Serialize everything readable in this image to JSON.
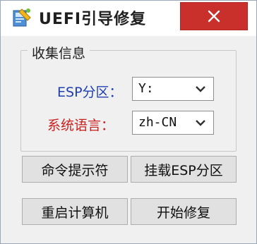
{
  "window": {
    "title": "UEFI引导修复",
    "icon": "repair-tool-icon",
    "close_icon": "close-icon"
  },
  "group": {
    "label": "收集信息"
  },
  "fields": {
    "esp_label": "ESP分区：",
    "esp_value": "Y:",
    "lang_label": "系统语言：",
    "lang_value": "zh-CN"
  },
  "buttons": {
    "cmd": "命令提示符",
    "mount": "挂载ESP分区",
    "reboot": "重启计算机",
    "repair": "开始修复"
  },
  "colors": {
    "close_button": "#c9302c",
    "esp_label": "#1f3fb0",
    "lang_label": "#c8201c"
  }
}
